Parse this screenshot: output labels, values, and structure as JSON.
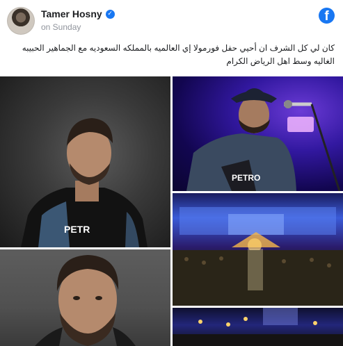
{
  "post": {
    "author": "Tamer Hosny",
    "verified": true,
    "timestamp": "on Sunday",
    "platform_icon": "facebook-logo-icon",
    "caption": "كان لي كل الشرف ان أحيي حفل فورمولا إي العالميه بالمملكه السعوديه مع الجماهير الحبيبه الغاليه وسط اهل الرياض الكرام"
  },
  "photos": [
    {
      "name": "photo-portrait-leather-jacket"
    },
    {
      "name": "photo-singing-microphone-hat"
    },
    {
      "name": "photo-concert-crowd-stage"
    },
    {
      "name": "photo-closeup-face"
    },
    {
      "name": "photo-stage-lights"
    }
  ],
  "colors": {
    "brand": "#1877f2",
    "author_text": "#1c1e21",
    "meta_text": "#90949c"
  }
}
